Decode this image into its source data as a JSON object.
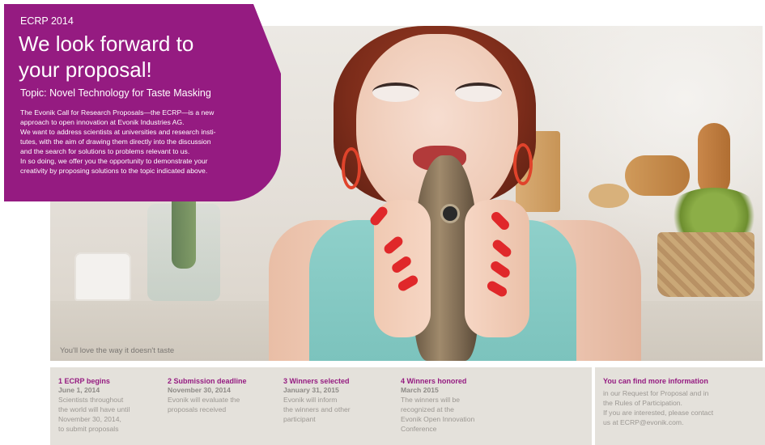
{
  "hero": {
    "kicker": "ECRP 2014",
    "title_line1": "We look forward to",
    "title_line2": "your proposal!",
    "topic": "Topic: Novel Technology for Taste Masking",
    "body_lines": [
      "The Evonik Call for Research Proposals—the ECRP—is a new",
      "approach to open innovation at Evonik Industries AG.",
      "We want to address scientists at universities and research insti-",
      "tutes, with the aim of drawing them directly into the discussion",
      "and the search for solutions to problems relevant to us.",
      "In so doing, we offer you the opportunity to demonstrate your",
      "creativity by proposing solutions to the topic indicated above."
    ]
  },
  "photo": {
    "tagline": "You'll love the way it doesn't taste"
  },
  "timeline": [
    {
      "title": "1 ECRP begins",
      "date": "June 1, 2014",
      "desc_lines": [
        "Scientists throughout",
        "the world will have until",
        "November 30, 2014,",
        "to submit proposals"
      ]
    },
    {
      "title": "2 Submission deadline",
      "date": "November 30, 2014",
      "desc_lines": [
        "Evonik will evaluate the",
        "proposals received"
      ]
    },
    {
      "title": "3 Winners selected",
      "date": "January 31, 2015",
      "desc_lines": [
        "Evonik will inform",
        "the winners and other",
        "participant"
      ]
    },
    {
      "title": "4 Winners honored",
      "date": "March 2015",
      "desc_lines": [
        "The winners will be",
        "recognized at the",
        "Evonik Open Innovation",
        "Conference"
      ]
    }
  ],
  "info": {
    "title": "You can find more information",
    "body_lines": [
      "in our Request for Proposal and in",
      "the Rules of Participation.",
      "If you are interested, please contact",
      "us at ECRP@evonik.com."
    ]
  },
  "colors": {
    "brand_purple": "#951b81",
    "panel_gray": "#e4e1db"
  }
}
